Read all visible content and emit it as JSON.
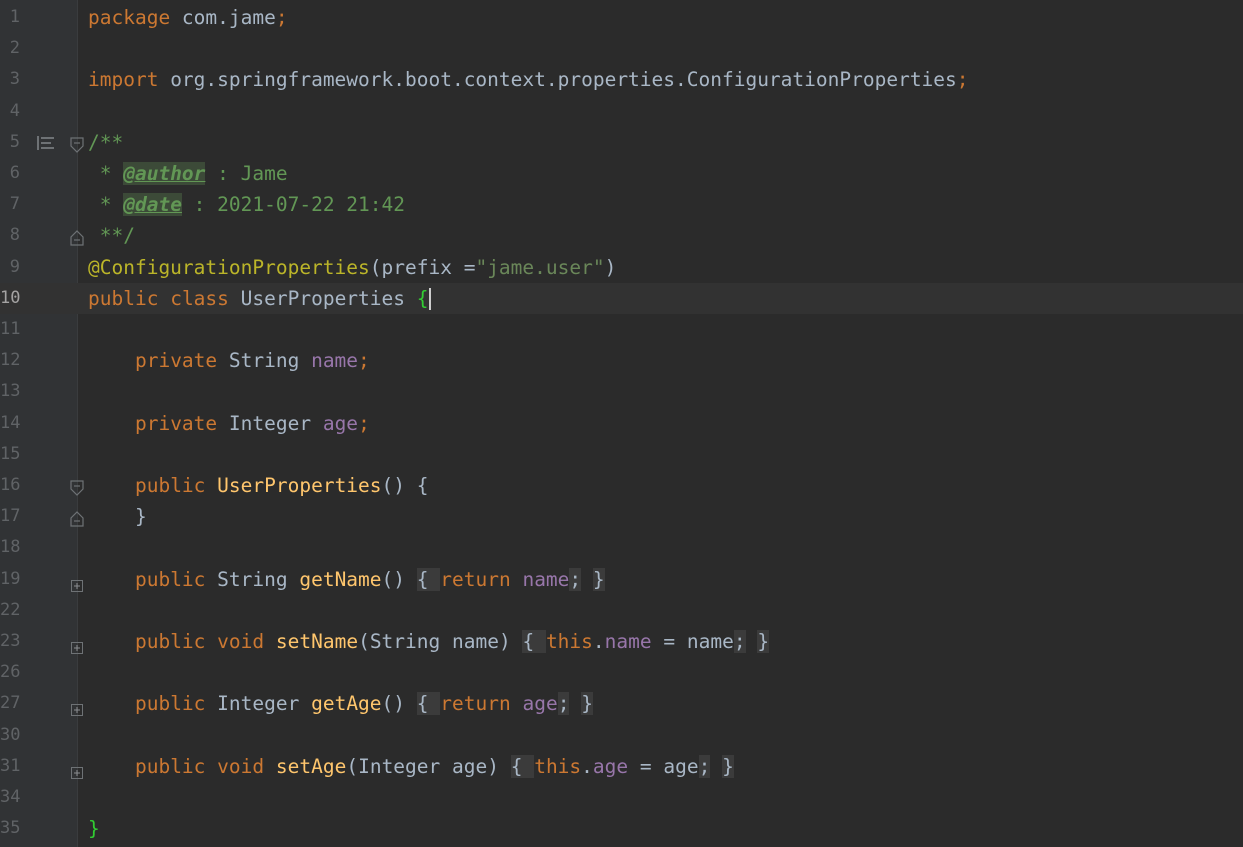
{
  "editor": {
    "language": "Java",
    "current_line": "10",
    "gutter_icon": "format-lines-icon",
    "lines": [
      {
        "num": "1",
        "text": "package com.jame;"
      },
      {
        "num": "2",
        "text": ""
      },
      {
        "num": "3",
        "text": "import org.springframework.boot.context.properties.ConfigurationProperties;"
      },
      {
        "num": "4",
        "text": ""
      },
      {
        "num": "5",
        "text": "/**"
      },
      {
        "num": "6",
        "text": " * @author : Jame"
      },
      {
        "num": "7",
        "text": " * @date : 2021-07-22 21:42"
      },
      {
        "num": "8",
        "text": " **/"
      },
      {
        "num": "9",
        "text": "@ConfigurationProperties(prefix =\"jame.user\")"
      },
      {
        "num": "10",
        "text": "public class UserProperties {"
      },
      {
        "num": "11",
        "text": ""
      },
      {
        "num": "12",
        "text": "    private String name;"
      },
      {
        "num": "13",
        "text": ""
      },
      {
        "num": "14",
        "text": "    private Integer age;"
      },
      {
        "num": "15",
        "text": ""
      },
      {
        "num": "16",
        "text": "    public UserProperties() {"
      },
      {
        "num": "17",
        "text": "    }"
      },
      {
        "num": "18",
        "text": ""
      },
      {
        "num": "19",
        "text": "    public String getName() { return name; }"
      },
      {
        "num": "22",
        "text": ""
      },
      {
        "num": "23",
        "text": "    public void setName(String name) { this.name = name; }"
      },
      {
        "num": "26",
        "text": ""
      },
      {
        "num": "27",
        "text": "    public Integer getAge() { return age; }"
      },
      {
        "num": "30",
        "text": ""
      },
      {
        "num": "31",
        "text": "    public void setAge(Integer age) { this.age = age; }"
      },
      {
        "num": "34",
        "text": ""
      },
      {
        "num": "35",
        "text": "}"
      }
    ],
    "colors": {
      "background": "#2b2b2b",
      "gutter": "#313335",
      "keyword": "#cc7832",
      "string": "#6a8759",
      "annotation": "#bbb529",
      "field": "#9876aa",
      "method": "#ffc66d",
      "doc_comment": "#629755",
      "matched_brace": "#32cd32"
    }
  }
}
